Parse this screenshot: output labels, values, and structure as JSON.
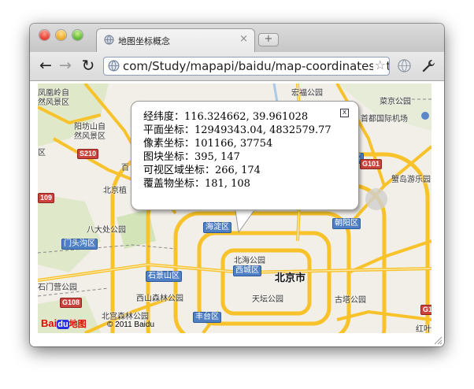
{
  "tab": {
    "title": "地图坐标概念",
    "close_glyph": "×",
    "new_tab_glyph": "+"
  },
  "toolbar": {
    "back_glyph": "←",
    "forward_glyph": "→",
    "reload_glyph": "↻",
    "url": "com/Study/mapapi/baidu/map-coordinates.html",
    "star_glyph": "☆"
  },
  "popup": {
    "close_glyph": "x",
    "lines": [
      "经纬度：116.324662, 39.961028",
      "平面坐标：12949343.04, 4832579.77",
      "像素坐标：101166, 37754",
      "图块坐标：395, 147",
      "可视区域坐标：266, 174",
      "覆盖物坐标：181, 108"
    ]
  },
  "map": {
    "city": "北京市",
    "labels": {
      "fenghuang": "凤凰岭自",
      "fengjingqu": "然风景区",
      "yangfang": "阳坊山自",
      "ranqu": "然风景区",
      "qu": "区",
      "baiwangshan": "百",
      "beian": "北京植",
      "badachu": "八大处公园",
      "shijingshan": "石景山区",
      "beihai": "北海公园",
      "shichajing": "石门营公园",
      "shandong": "西山森林公园",
      "tiantan": "天坛公园",
      "gongyuan2": "古塔公园",
      "beigong": "北宫森林公园",
      "honglu": "宏福公园",
      "caichang": "菜京公园",
      "shoudu": "首都国际机场",
      "xianfang": "蟹岛游乐园",
      "hongyebao": "红叶"
    },
    "tags": {
      "haidian": "海淀区",
      "mentougou": "门头沟区",
      "shijingshan": "石景山区",
      "xicheng": "西城区",
      "chaoyang1": "朝阳区",
      "chaoyang2": "朝阳区",
      "fengtai": "丰台区"
    },
    "road_tags": {
      "s210": "S210",
      "g101": "G101",
      "g108": "G108",
      "n109": "109",
      "g1": "G1"
    },
    "logo_bai": "Bai",
    "logo_du": "du",
    "logo_ditu": "地图",
    "copyright": "© 2011 Baidu"
  }
}
